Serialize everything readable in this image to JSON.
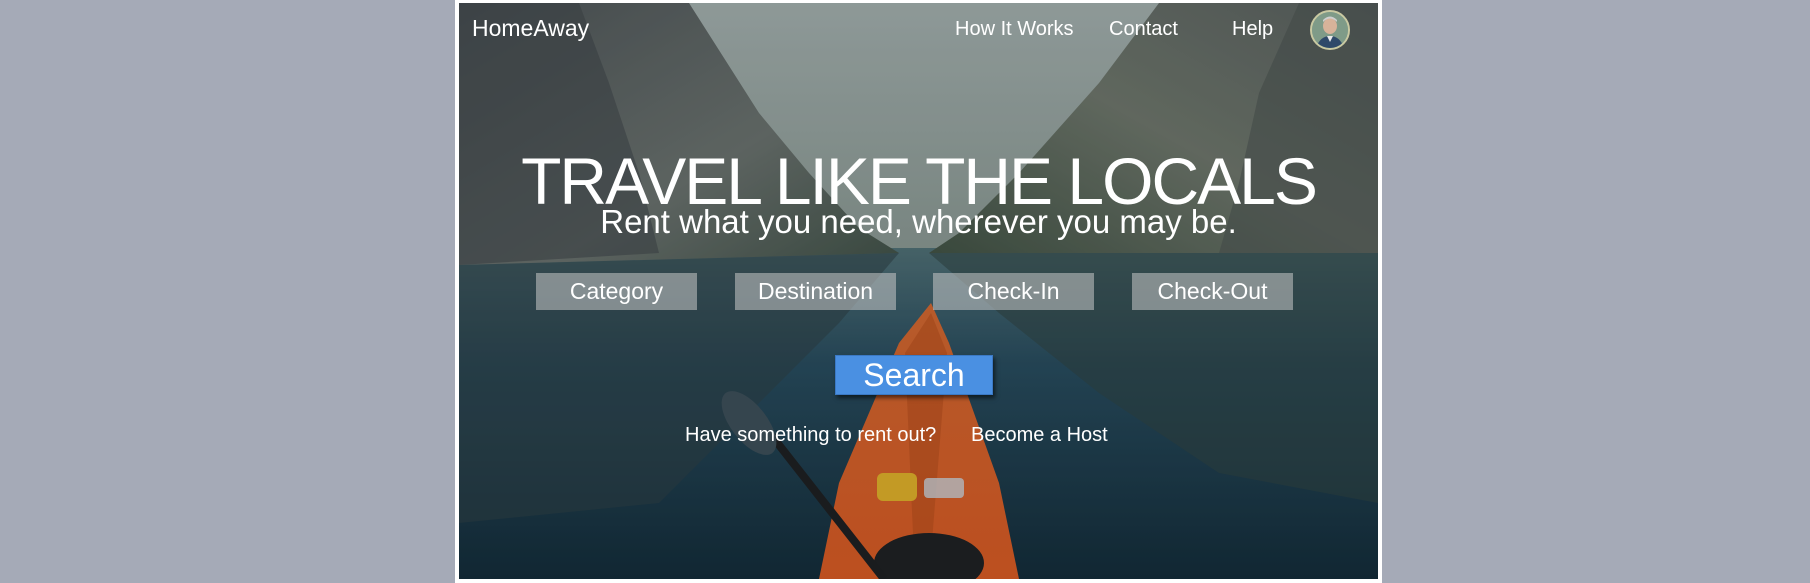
{
  "header": {
    "brand": "HomeAway",
    "nav": {
      "how_it_works": "How It Works",
      "contact": "Contact",
      "help": "Help"
    }
  },
  "hero": {
    "headline": "TRAVEL LIKE THE LOCALS",
    "subheadline": "Rent what you need, wherever you may be.",
    "fields": {
      "category": "Category",
      "destination": "Destination",
      "check_in": "Check-In",
      "check_out": "Check-Out"
    },
    "search_label": "Search",
    "host_prompt": "Have something to rent out?",
    "host_link": "Become a Host"
  },
  "colors": {
    "page_background": "#a5aab7",
    "search_button": "#4a90e2",
    "text": "#ffffff"
  }
}
